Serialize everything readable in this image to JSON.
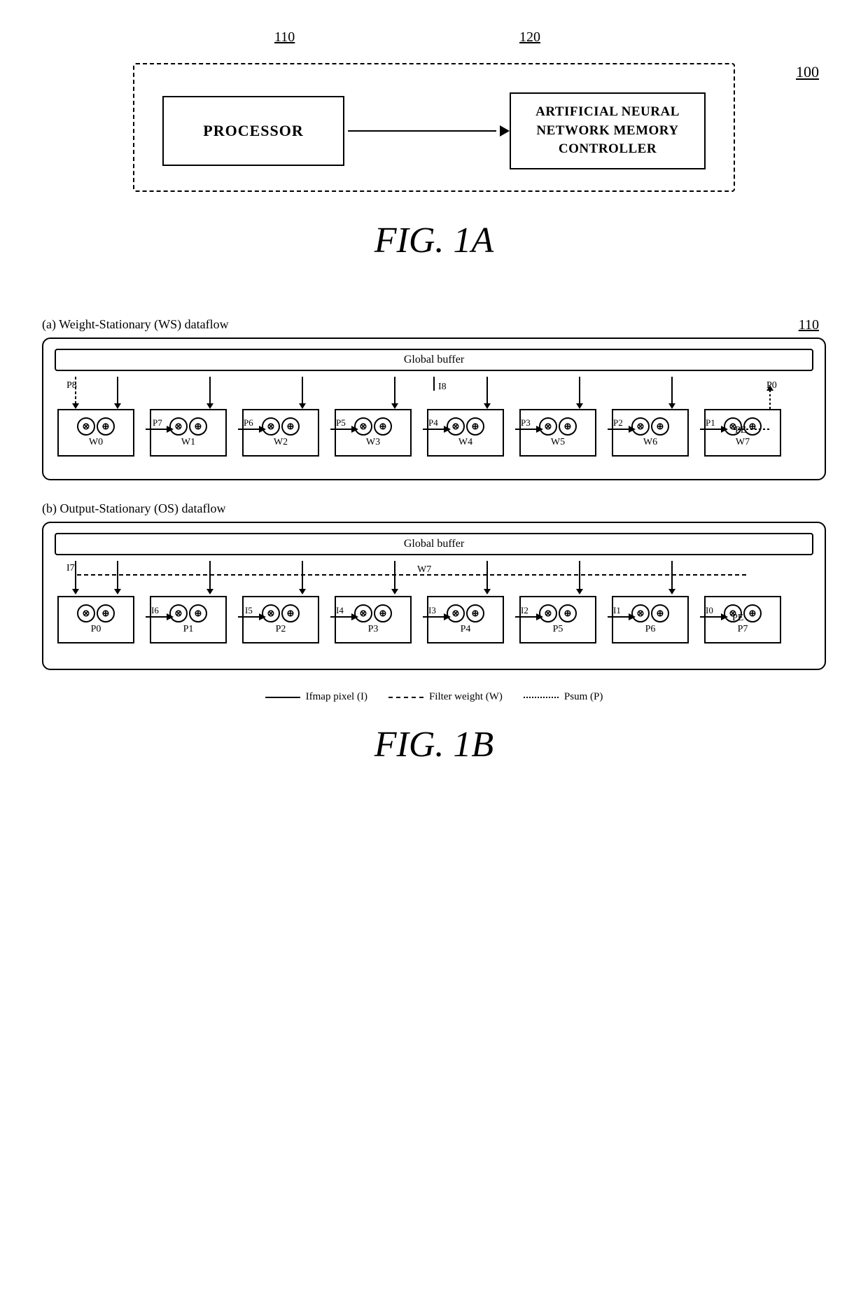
{
  "fig1a": {
    "ref_main": "100",
    "label_110": "110",
    "label_120": "120",
    "processor_text": "PROCESSOR",
    "ann_text": "ARTIFICIAL NEURAL\nNETWORK MEMORY\nCONTROLLER",
    "caption": "FIG. 1A"
  },
  "fig1b": {
    "ref_110": "110",
    "subfig_a_label": "(a) Weight-Stationary (WS) dataflow",
    "subfig_b_label": "(b) Output-Stationary (OS) dataflow",
    "global_buffer_text": "Global buffer",
    "ws_pes": [
      "W0",
      "W1",
      "W2",
      "W3",
      "W4",
      "W5",
      "W6",
      "W7"
    ],
    "ws_p_labels": [
      "P8",
      "P7",
      "P6",
      "P5",
      "P4",
      "P3",
      "P2",
      "P1",
      "PE"
    ],
    "ws_i_label": "I8",
    "ws_p0_label": "P0",
    "os_pes": [
      "P0",
      "P1",
      "P2",
      "P3",
      "P4",
      "P5",
      "P6",
      "P7"
    ],
    "os_i_labels": [
      "I7",
      "I6",
      "I5",
      "I4",
      "I3",
      "I2",
      "I1",
      "I0"
    ],
    "os_w_label": "W7",
    "os_pe_end": "PE",
    "legend_solid": "Ifmap pixel (I)",
    "legend_dashed": "Filter weight (W)",
    "legend_dotted": "Psum (P)",
    "caption": "FIG. 1B"
  }
}
